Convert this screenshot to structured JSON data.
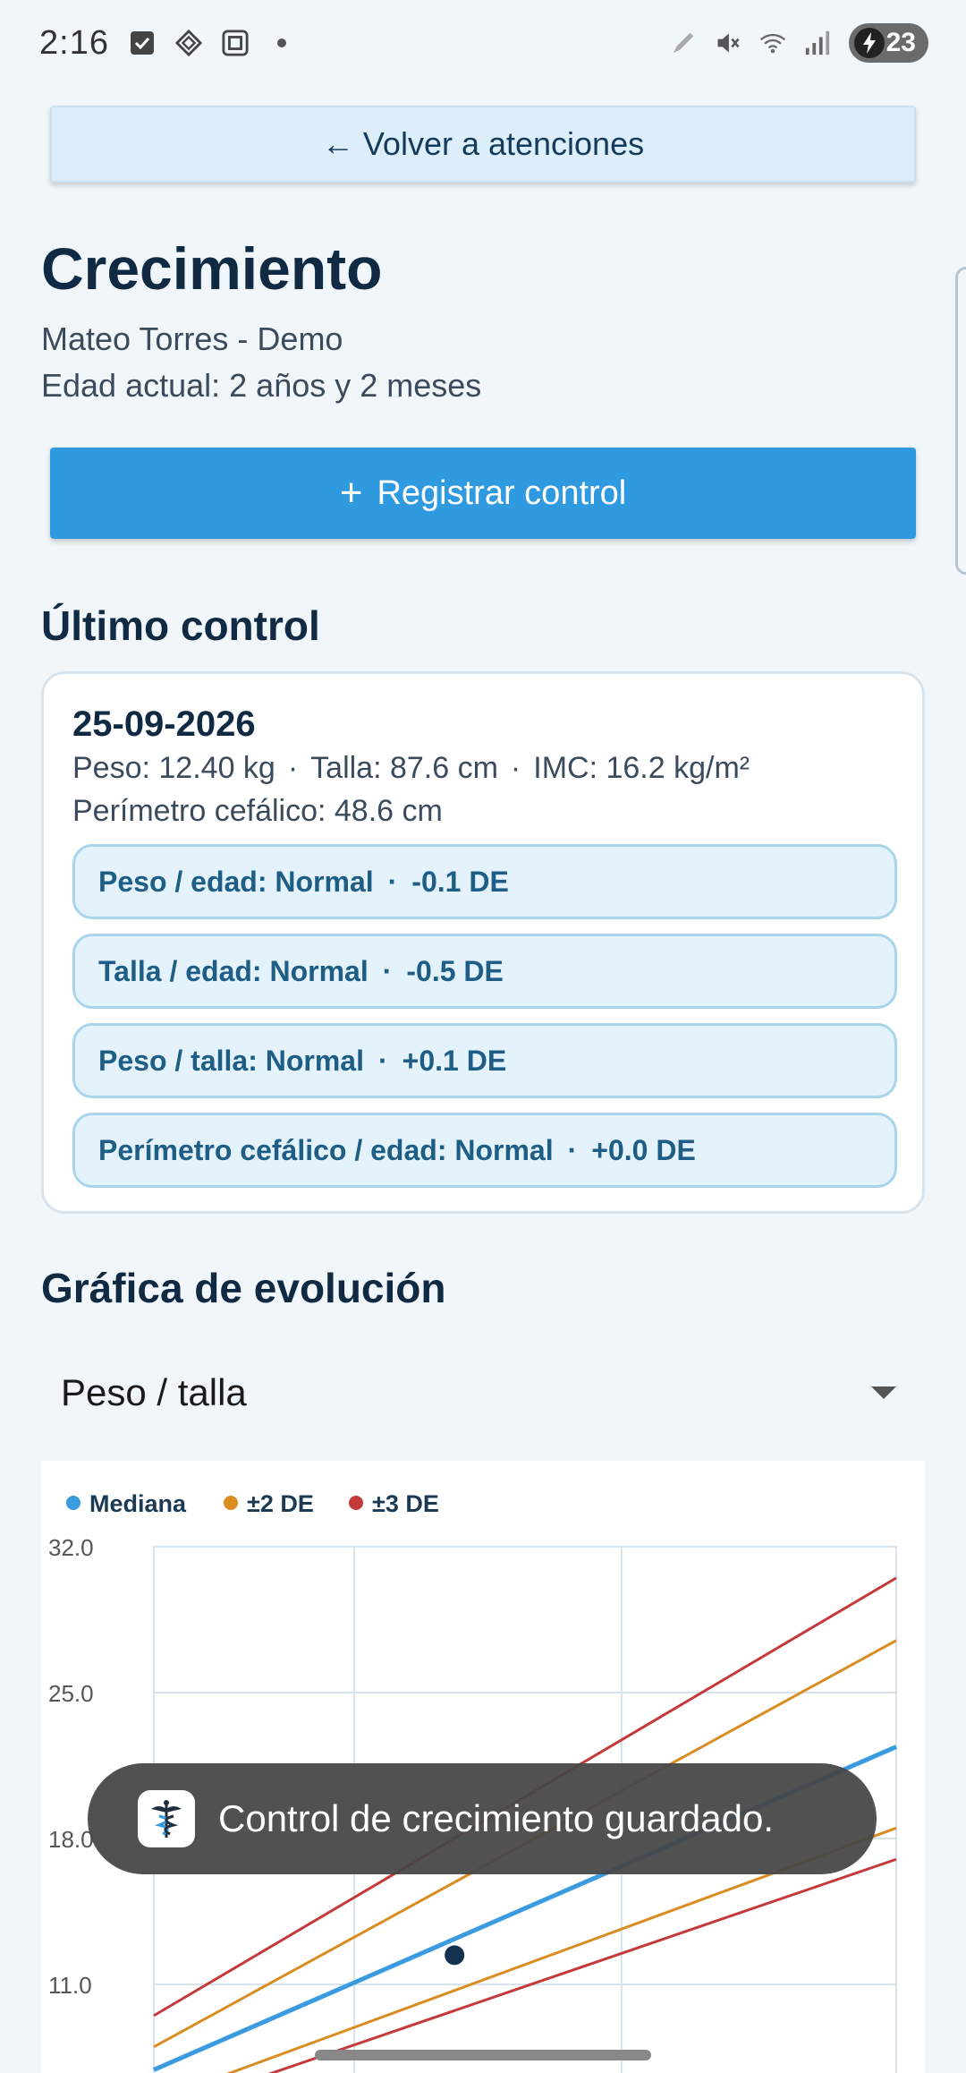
{
  "status_bar": {
    "time": "2:16",
    "battery": "23",
    "icons": [
      "checkbox-icon",
      "diamond-grid-icon",
      "square-app-icon",
      "dot-icon",
      "pen-icon",
      "mute-icon",
      "wifi-icon",
      "signal-icon",
      "battery-icon"
    ]
  },
  "back_button": {
    "label": "← Volver a atenciones"
  },
  "header": {
    "title": "Crecimiento",
    "patient": "Mateo Torres - Demo",
    "age": "Edad actual: 2 años y 2 meses"
  },
  "register_button": {
    "icon": "+",
    "label": "Registrar control"
  },
  "last_control": {
    "section_title": "Último control",
    "date": "25-09-2026",
    "weight": "Peso: 12.40 kg",
    "height": "Talla: 87.6 cm",
    "bmi": "IMC: 16.2 kg/m²",
    "head": "Perímetro cefálico: 48.6 cm",
    "separator": "·",
    "indicators": [
      {
        "label": "Peso / edad: Normal",
        "value": "-0.1 DE"
      },
      {
        "label": "Talla / edad: Normal",
        "value": "-0.5 DE"
      },
      {
        "label": "Peso / talla: Normal",
        "value": "+0.1 DE"
      },
      {
        "label": "Perímetro cefálico / edad: Normal",
        "value": "+0.0 DE"
      }
    ]
  },
  "chart_section": {
    "title": "Gráfica de evolución",
    "selected": "Peso / talla"
  },
  "colors": {
    "median": "#3a9be0",
    "sd2": "#d98c1f",
    "sd3": "#c43a3a",
    "point": "#12324f",
    "primary": "#2f9ae0"
  },
  "chart_data": {
    "type": "line",
    "legend": [
      "Mediana",
      "±2 DE",
      "±3 DE"
    ],
    "y_ticks": [
      "32.0",
      "25.0",
      "18.0",
      "11.0"
    ],
    "ylim": [
      5.2,
      32
    ],
    "x_range": [
      0,
      100
    ],
    "series": [
      {
        "name": "Mediana",
        "role": "median",
        "x": [
          0,
          100
        ],
        "y": [
          6.9,
          22.4
        ]
      },
      {
        "name": "±2 DE",
        "role": "sd2",
        "x": [
          0,
          100
        ],
        "y": [
          8.0,
          27.5
        ]
      },
      {
        "name": "±2 DE",
        "role": "sd2",
        "x": [
          0,
          100
        ],
        "y": [
          5.4,
          18.5
        ]
      },
      {
        "name": "±3 DE",
        "role": "sd3",
        "x": [
          0,
          100
        ],
        "y": [
          9.5,
          30.5
        ]
      },
      {
        "name": "±3 DE",
        "role": "sd3",
        "x": [
          0,
          100
        ],
        "y": [
          4.8,
          17.0
        ]
      }
    ],
    "points": [
      {
        "x": 40.5,
        "y": 12.4
      }
    ]
  },
  "toast": {
    "message": "Control de crecimiento guardado."
  }
}
